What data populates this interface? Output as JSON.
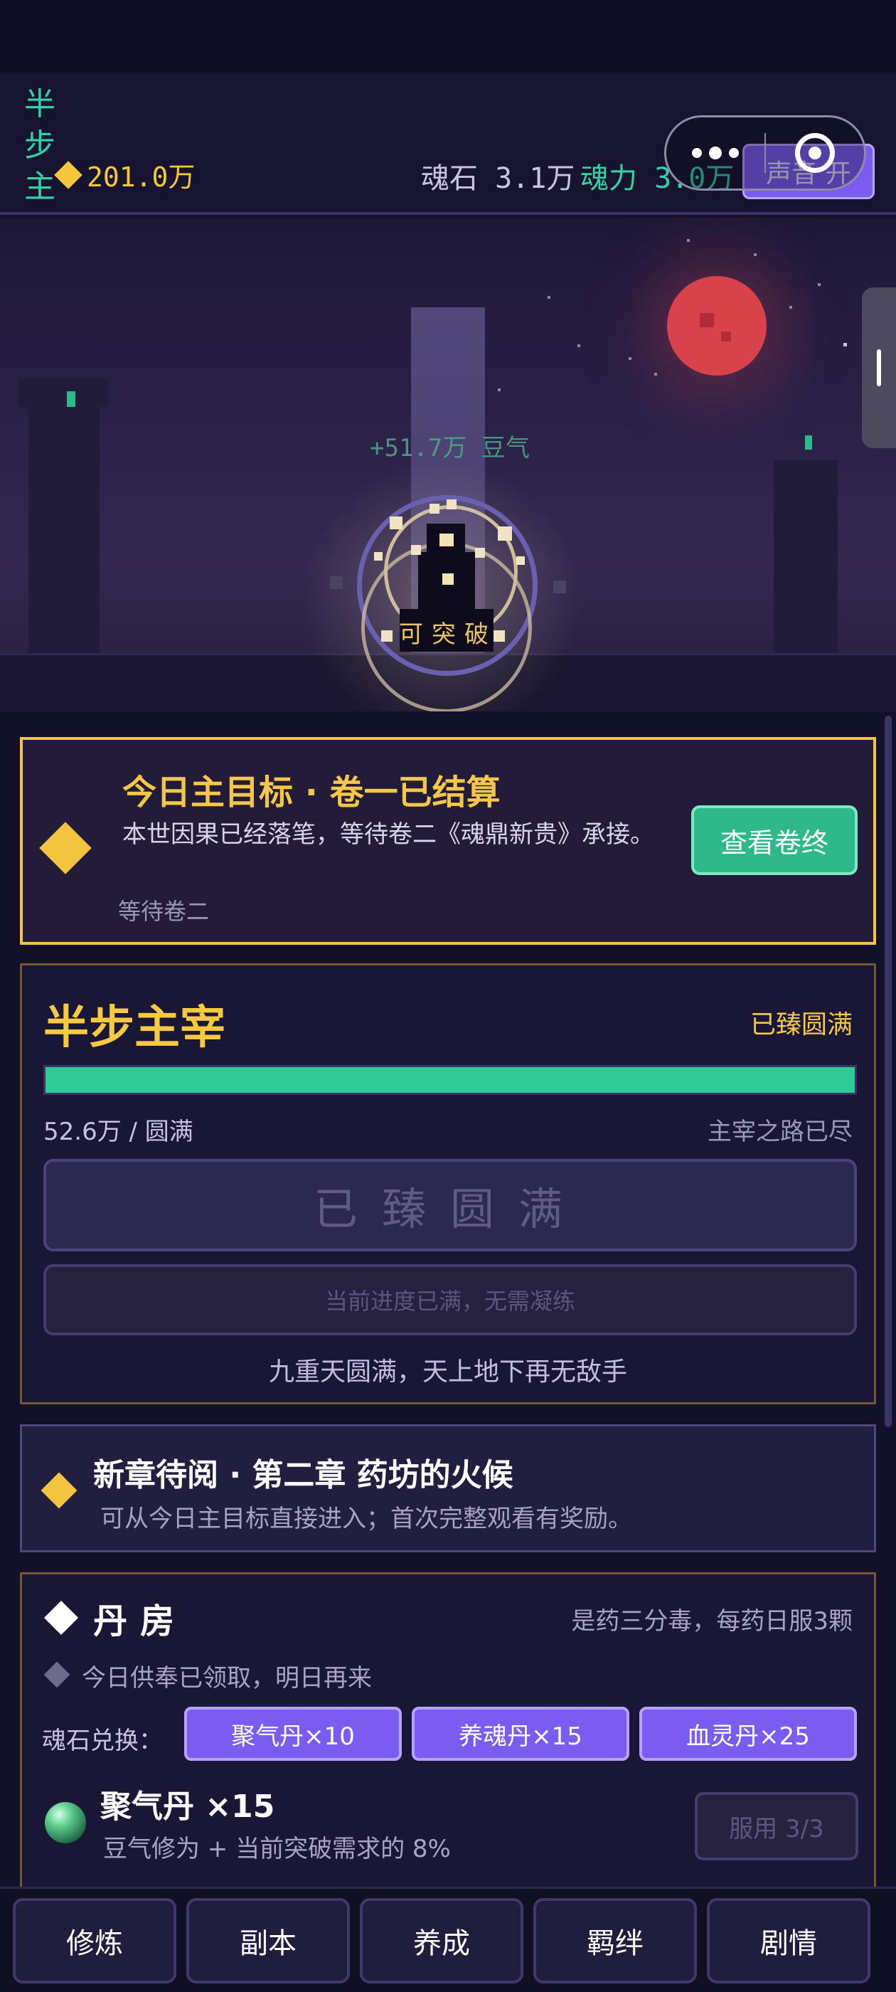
{
  "header": {
    "realm_short": "半步主",
    "gold": "201.0万",
    "soulstone_label": "魂石",
    "soulstone_value": "3.1万",
    "soulpower_label": "魂力",
    "soulpower_value": "3.0万",
    "sound_button": "声音 开"
  },
  "scene": {
    "gain_text": "+51.7万 豆气",
    "breakthrough_text": "可突破"
  },
  "goal": {
    "title": "今日主目标 · 卷一已结算",
    "description": "本世因果已经落笔，等待卷二《魂鼎新贵》承接。",
    "sub": "等待卷二",
    "button": "查看卷终"
  },
  "realm": {
    "name": "半步主宰",
    "status": "已臻圆满",
    "progress_fraction": 1.0,
    "current": "52.6万 / 圆满",
    "road": "主宰之路已尽",
    "main_button": "已臻圆满",
    "note_button": "当前进度已满，无需凝练",
    "footer": "九重天圆满，天上地下再无敌手"
  },
  "chapter": {
    "title": "新章待阅 · 第二章 药坊的火候",
    "description": "可从今日主目标直接进入；首次完整观看有奖励。"
  },
  "pharmacy": {
    "title": "丹房",
    "note": "是药三分毒，每药日服3颗",
    "claim": "今日供奉已领取，明日再来",
    "exchange_label": "魂石兑换：",
    "exchanges": [
      "聚气丹×10",
      "养魂丹×15",
      "血灵丹×25"
    ],
    "pill_name": "聚气丹 ×15",
    "pill_desc": "豆气修为 + 当前突破需求的 8%",
    "use_button": "服用 3/3"
  },
  "nav": {
    "tabs": [
      "修炼",
      "副本",
      "养成",
      "羁绊",
      "剧情"
    ]
  },
  "colors": {
    "accent_gold": "#f4c64a",
    "accent_green": "#2ecb96",
    "accent_purple": "#7a5cf0"
  }
}
